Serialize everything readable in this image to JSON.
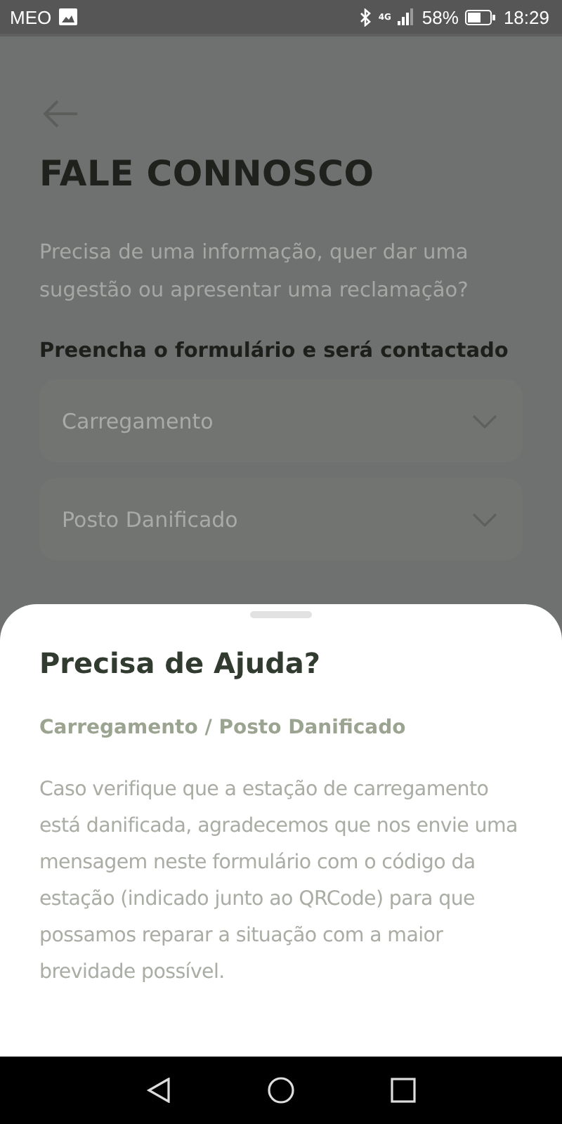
{
  "status_bar": {
    "carrier": "MEO",
    "network": "4G",
    "battery": "58%",
    "time": "18:29"
  },
  "page": {
    "title": "FALE CONNOSCO",
    "intro": "Precisa de uma informação, quer dar uma sugestão ou apresentar uma reclamação?",
    "form_label": "Preencha o formulário e será contactado",
    "fields": [
      {
        "value": "Carregamento"
      },
      {
        "value": "Posto Danificado"
      }
    ]
  },
  "sheet": {
    "title": "Precisa de Ajuda?",
    "subtitle": "Carregamento / Posto Danificado",
    "body": "Caso verifique que a estação de carregamento está danificada, agradecemos que nos envie uma mensagem neste formulário com o código da estação (indicado junto ao QRCode) para que possamos reparar a situação com a maior brevidade possível."
  }
}
